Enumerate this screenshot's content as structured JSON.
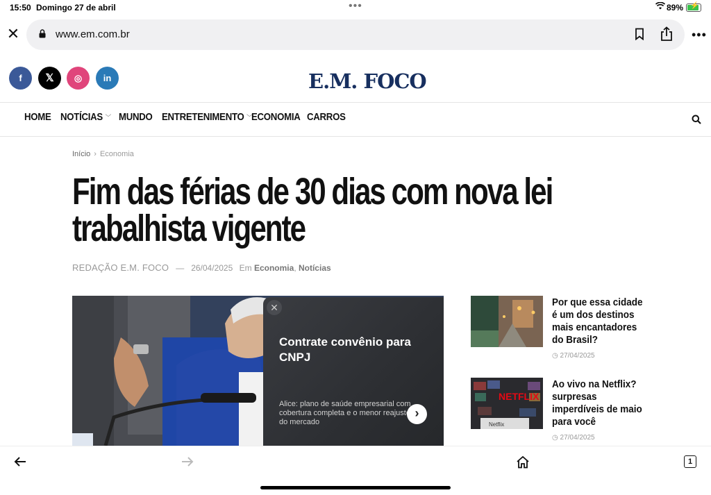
{
  "status": {
    "time": "15:50",
    "date": "Domingo 27 de abril",
    "battery": "89%"
  },
  "browser": {
    "url": "www.em.com.br",
    "tab_count": "1"
  },
  "site": {
    "logo": "E.M. FOCO"
  },
  "social": {
    "facebook": "f",
    "x": "𝕏",
    "instagram": "◎",
    "linkedin": "in"
  },
  "nav": {
    "items": [
      {
        "label": "HOME",
        "has_dropdown": false
      },
      {
        "label": "NOTÍCIAS",
        "has_dropdown": true
      },
      {
        "label": "MUNDO",
        "has_dropdown": false
      },
      {
        "label": "ENTRETENIMENTO",
        "has_dropdown": true
      },
      {
        "label": "ECONOMIA",
        "has_dropdown": false
      },
      {
        "label": "CARROS",
        "has_dropdown": false
      }
    ]
  },
  "breadcrumb": {
    "home": "Início",
    "current": "Economia"
  },
  "article": {
    "title": "Fim das férias de 30 dias com nova lei trabalhista vigente",
    "author": "REDAÇÃO E.M. FOCO",
    "date": "26/04/2025",
    "in_label": "Em",
    "cat1": "Economia",
    "cat2": "Notícias"
  },
  "ad": {
    "title": "Contrate convênio para CNPJ",
    "description": "Alice: plano de saúde empresarial com cobertura completa e o menor reajuste do mercado"
  },
  "side": [
    {
      "title": "Por que essa cidade é um dos destinos mais encantadores do Brasil?",
      "date": "27/04/2025"
    },
    {
      "title": "Ao vivo na Netflix? surpresas imperdíveis de maio para você",
      "date": "27/04/2025"
    }
  ],
  "colors": {
    "logo": "#172f5f",
    "facebook": "#3b5998",
    "instagram": "#e0457b",
    "linkedin": "#2a7ab7"
  }
}
